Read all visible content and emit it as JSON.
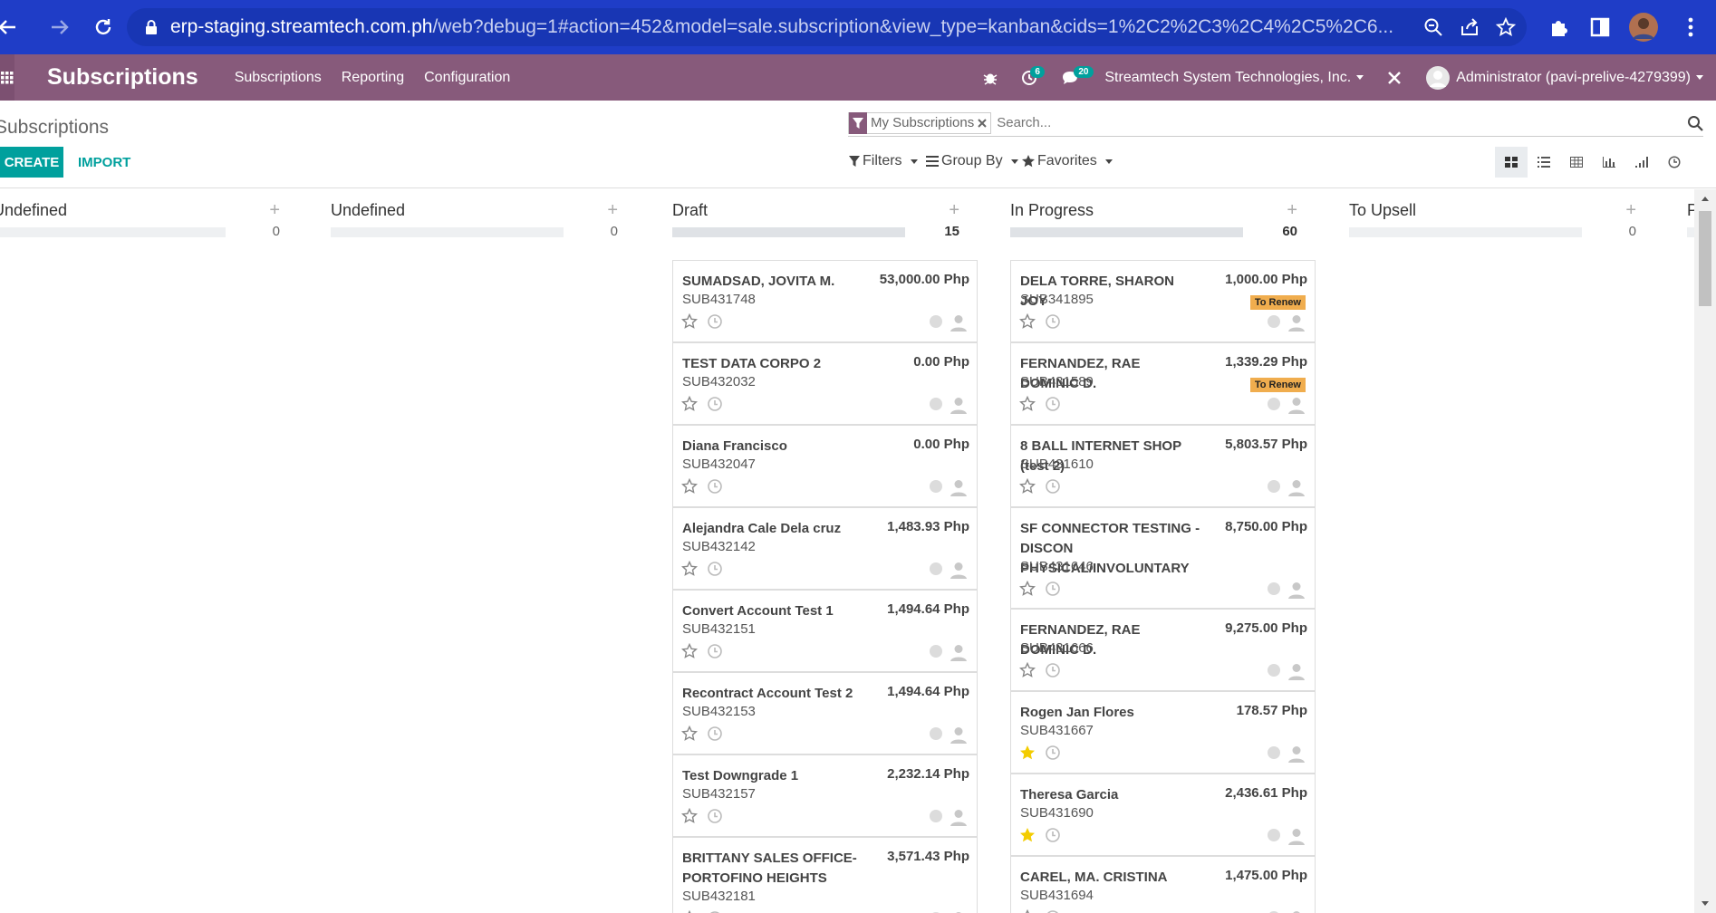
{
  "browser": {
    "url_host": "erp-staging.streamtech.com.ph",
    "url_path": "/web?debug=1#action=452&model=sale.subscription&view_type=kanban&cids=1%2C2%2C3%2C4%2C5%2C6..."
  },
  "navbar": {
    "brand": "Subscriptions",
    "menu": [
      "Subscriptions",
      "Reporting",
      "Configuration"
    ],
    "activity_count": "6",
    "message_count": "20",
    "company": "Streamtech System Technologies, Inc.",
    "user": "Administrator (pavi-prelive-4279399)"
  },
  "control_panel": {
    "breadcrumb": "Subscriptions",
    "create_label": "CREATE",
    "import_label": "IMPORT",
    "facet": "My Subscriptions",
    "search_placeholder": "Search...",
    "filters_label": "Filters",
    "groupby_label": "Group By",
    "favorites_label": "Favorites"
  },
  "kanban": {
    "columns": [
      {
        "title": "Undefined",
        "count": "0",
        "cards": []
      },
      {
        "title": "Undefined",
        "count": "0",
        "cards": []
      },
      {
        "title": "Draft",
        "count": "15",
        "cards": [
          {
            "name": "SUMADSAD, JOVITA M.",
            "amount": "53,000.00 Php",
            "ref": "SUB431748",
            "tag": "",
            "starred": false
          },
          {
            "name": "TEST DATA CORPO 2",
            "amount": "0.00 Php",
            "ref": "SUB432032",
            "tag": "",
            "starred": false
          },
          {
            "name": "Diana Francisco",
            "amount": "0.00 Php",
            "ref": "SUB432047",
            "tag": "",
            "starred": false
          },
          {
            "name": "Alejandra Cale Dela cruz",
            "amount": "1,483.93 Php",
            "ref": "SUB432142",
            "tag": "",
            "starred": false
          },
          {
            "name": "Convert Account Test 1",
            "amount": "1,494.64 Php",
            "ref": "SUB432151",
            "tag": "",
            "starred": false
          },
          {
            "name": "Recontract Account Test 2",
            "amount": "1,494.64 Php",
            "ref": "SUB432153",
            "tag": "",
            "starred": false
          },
          {
            "name": "Test Downgrade 1",
            "amount": "2,232.14 Php",
            "ref": "SUB432157",
            "tag": "",
            "starred": false
          },
          {
            "name": "BRITTANY SALES OFFICE-PORTOFINO HEIGHTS",
            "amount": "3,571.43 Php",
            "ref": "SUB432181",
            "tag": "",
            "starred": false
          }
        ]
      },
      {
        "title": "In Progress",
        "count": "60",
        "cards": [
          {
            "name": "DELA TORRE, SHARON JOY",
            "amount": "1,000.00 Php",
            "ref": "SUB341895",
            "tag": "To Renew",
            "starred": false
          },
          {
            "name": "FERNANDEZ, RAE DOMINIC D.",
            "amount": "1,339.29 Php",
            "ref": "SUB431589",
            "tag": "To Renew",
            "starred": false
          },
          {
            "name": "8 BALL INTERNET SHOP (test 2)",
            "amount": "5,803.57 Php",
            "ref": "SUB431610",
            "tag": "",
            "starred": false
          },
          {
            "name": "SF CONNECTOR TESTING - DISCON PHYSICAL/INVOLUNTARY",
            "amount": "8,750.00 Php",
            "ref": "SUB431646",
            "tag": "",
            "starred": false
          },
          {
            "name": "FERNANDEZ, RAE DOMINIC D.",
            "amount": "9,275.00 Php",
            "ref": "SUB431666",
            "tag": "",
            "starred": false
          },
          {
            "name": "Rogen Jan Flores",
            "amount": "178.57 Php",
            "ref": "SUB431667",
            "tag": "",
            "starred": true
          },
          {
            "name": "Theresa Garcia",
            "amount": "2,436.61 Php",
            "ref": "SUB431690",
            "tag": "",
            "starred": true
          },
          {
            "name": "CAREL, MA. CRISTINA",
            "amount": "1,475.00 Php",
            "ref": "SUB431694",
            "tag": "",
            "starred": false
          }
        ]
      },
      {
        "title": "To Upsell",
        "count": "0",
        "cards": []
      },
      {
        "title": "P",
        "count": "",
        "cards": []
      }
    ]
  },
  "colors": {
    "brand": "#875a7b",
    "accent": "#00a09d",
    "tag": "#f0ad4e",
    "star_on": "#f3cc00"
  },
  "icons": [
    "back-arrow-icon",
    "forward-arrow-icon",
    "reload-icon",
    "lock-icon",
    "zoom-icon",
    "share-icon",
    "bookmark-star-icon",
    "extensions-icon",
    "sidepanel-icon",
    "profile-icon",
    "kebab-menu-icon",
    "apps-grid-icon",
    "bug-icon",
    "activity-icon",
    "chat-icon",
    "close-icon",
    "avatar-icon",
    "filter-icon",
    "search-icon",
    "kanban-view-icon",
    "list-view-icon",
    "pivot-view-icon",
    "graph-view-icon",
    "cohort-view-icon",
    "activity-view-icon",
    "star-icon",
    "clock-icon",
    "user-icon"
  ]
}
